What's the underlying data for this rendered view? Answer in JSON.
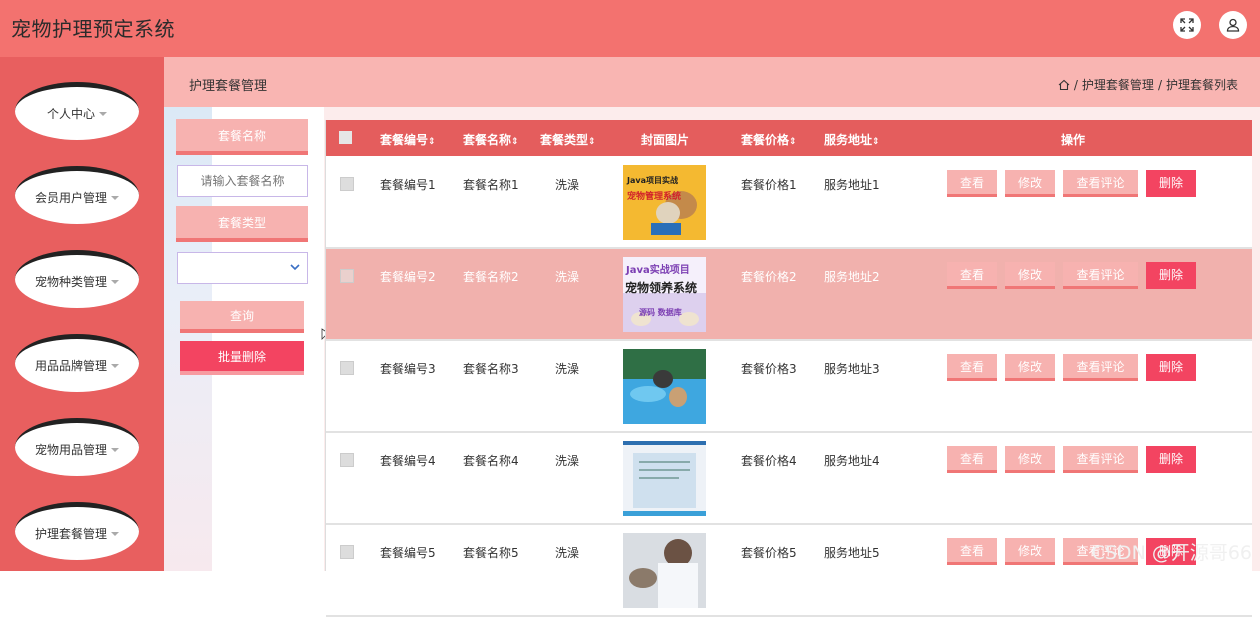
{
  "app": {
    "title": "宠物护理预定系统"
  },
  "sidebar": {
    "items": [
      {
        "label": "个人中心"
      },
      {
        "label": "会员用户管理"
      },
      {
        "label": "宠物种类管理"
      },
      {
        "label": "用品品牌管理"
      },
      {
        "label": "宠物用品管理"
      },
      {
        "label": "护理套餐管理"
      }
    ]
  },
  "page": {
    "title": "护理套餐管理",
    "breadcrumb": [
      "护理套餐管理",
      "护理套餐列表"
    ]
  },
  "filters": {
    "name_label": "套餐名称",
    "name_placeholder": "请输入套餐名称",
    "type_label": "套餐类型",
    "query_button": "查询",
    "batch_delete_button": "批量删除"
  },
  "table": {
    "columns": [
      "套餐编号",
      "套餐名称",
      "套餐类型",
      "封面图片",
      "套餐价格",
      "服务地址",
      "操作"
    ],
    "actions": [
      "查看",
      "修改",
      "查看评论",
      "删除"
    ],
    "rows": [
      {
        "code": "套餐编号1",
        "name": "套餐名称1",
        "type": "洗澡",
        "price": "套餐价格1",
        "address": "服务地址1",
        "image_text": [
          "Java项目实战",
          "宠物管理系统"
        ]
      },
      {
        "code": "套餐编号2",
        "name": "套餐名称2",
        "type": "洗澡",
        "price": "套餐价格2",
        "address": "服务地址2",
        "image_text": [
          "Java实战项目",
          "宠物领养系统",
          "源码 数据库"
        ]
      },
      {
        "code": "套餐编号3",
        "name": "套餐名称3",
        "type": "洗澡",
        "price": "套餐价格3",
        "address": "服务地址3"
      },
      {
        "code": "套餐编号4",
        "name": "套餐名称4",
        "type": "洗澡",
        "price": "套餐价格4",
        "address": "服务地址4"
      },
      {
        "code": "套餐编号5",
        "name": "套餐名称5",
        "type": "洗澡",
        "price": "套餐价格5",
        "address": "服务地址5"
      }
    ]
  },
  "watermark": "CSDN @开源哥66",
  "colors": {
    "topbar": "#f3726f",
    "sidebar": "#e85f5f",
    "table_header": "#e45d5d",
    "button_light": "#f7b2b0",
    "button_danger": "#f34461",
    "selected_row": "#f1b1ad"
  }
}
